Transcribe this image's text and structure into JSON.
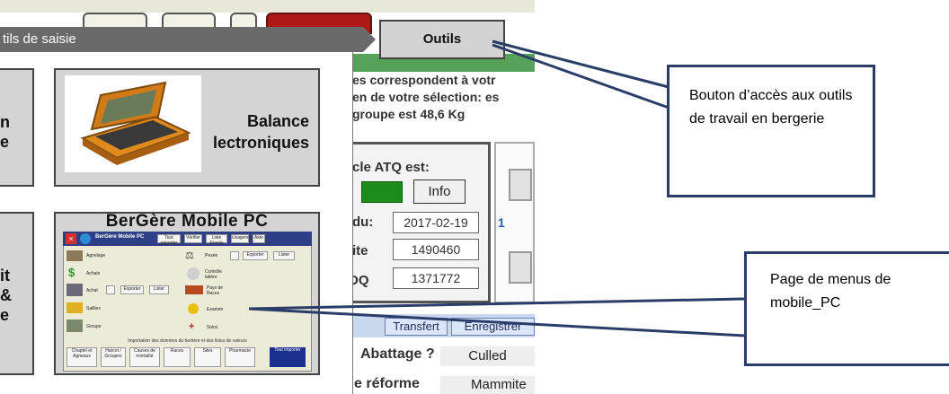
{
  "dialog": {
    "title": "tils de saisie"
  },
  "tool_button": {
    "label": "Outils"
  },
  "tiles": {
    "left_top_fragment": "n\ne",
    "left_bottom_fragment": "it\n&\ne",
    "balance": {
      "line1": "Balance",
      "line2": "lectroniques"
    },
    "bergere": {
      "title": "BerGère Mobile PC"
    }
  },
  "mini_app": {
    "header_title": "BerGère Mobile PC",
    "top_buttons": [
      "Tout exporter",
      "Vérifier",
      "Liste Envois",
      "Usagers",
      "Aide"
    ],
    "left_items": [
      "Agnelage",
      "Achats",
      "Achat",
      "Saillies",
      "Groupe"
    ],
    "center_items": [
      "Exporter",
      "Lister"
    ],
    "right_items": [
      "Pesée",
      "Contrôle latière",
      "Pays de Races",
      "Examen",
      "Soins"
    ],
    "right_actions": [
      "Exporter",
      "Lister"
    ],
    "footer_text": "Importation des données du bertière et des listes de valeurs",
    "footer_buttons": [
      "Chaptel et Agneaux",
      "Harcot / Groupes",
      "Causes de mortalité",
      "Races",
      "Sites",
      "Pharmacie",
      "Tout importer"
    ]
  },
  "background": {
    "text_lines": [
      "es correspondent à votr",
      "en de votre sélection: es",
      "groupe est 48,6 Kg"
    ],
    "atq_label": "cle ATQ est:",
    "info_button": "Info",
    "rows": [
      {
        "label": "du:",
        "value": "2017-02-19"
      },
      {
        "label": "ite",
        "value": "1490460"
      },
      {
        "label": "DQ",
        "value": "1371772"
      }
    ],
    "count": "1",
    "tabs": [
      "Transfert",
      "Enregistrer"
    ],
    "abattage_label": "Abattage ?",
    "abattage_value": "Culled",
    "reforme_label": "e réforme",
    "reforme_value": "Mammite"
  },
  "callouts": {
    "top": "Bouton d’accès aux outils de travail en bergerie",
    "bottom": "Page de menus de mobile_PC"
  },
  "colors": {
    "title_bar": "#6a6a6a",
    "callout_border": "#2a3c68",
    "green_band": "#58a158"
  }
}
